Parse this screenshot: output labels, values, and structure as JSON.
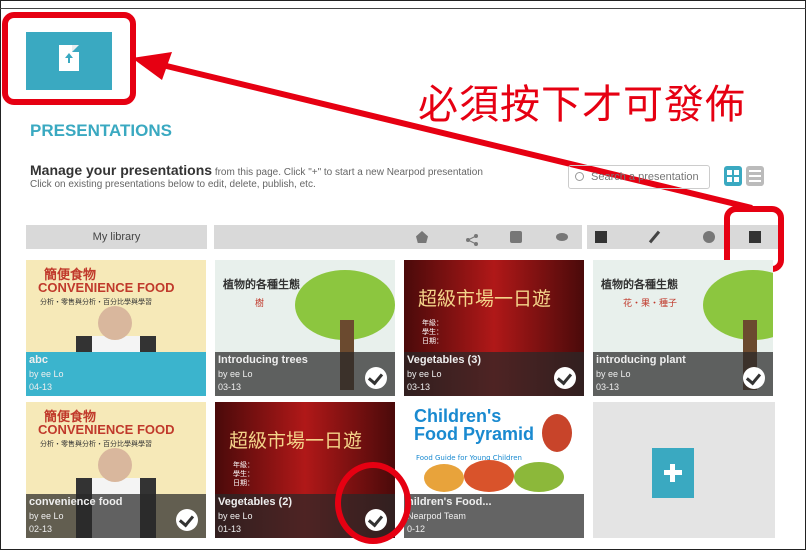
{
  "annotation": {
    "text": "必須按下才可發佈",
    "color": "#e60012"
  },
  "header": {
    "title": "PRESENTATIONS",
    "accent": "#3aa9c1"
  },
  "intro": {
    "bold": "Manage your presentations",
    "line1": " from this page. Click \"+\" to start a new Nearpod presentation",
    "line2": "Click on existing presentations below to edit, delete, publish, etc."
  },
  "search": {
    "placeholder": "Search a presentation"
  },
  "toolbar": {
    "library_label": "My library"
  },
  "cards": [
    {
      "title": "abc",
      "author": "by ee Lo",
      "date": "04-13",
      "selected": true,
      "thumb_text": [
        "簡便食物",
        "CONVENIENCE FOOD",
        "分析・零售與分析・百分比學與學習"
      ]
    },
    {
      "title": "Introducing trees",
      "author": "by ee Lo",
      "date": "03-13",
      "thumb_text": [
        "植物的各種生態",
        "樹"
      ]
    },
    {
      "title": "Vegetables (3)",
      "author": "by ee Lo",
      "date": "03-13",
      "thumb_text": [
        "超級市場一日遊",
        "年級：",
        "學生：",
        "日期："
      ]
    },
    {
      "title": "introducing plant",
      "author": "by ee Lo",
      "date": "03-13",
      "thumb_text": [
        "植物的各種生態",
        "花・果・種子"
      ]
    },
    {
      "title": "convenience food",
      "author": "by ee Lo",
      "date": "02-13",
      "thumb_text": [
        "簡便食物",
        "CONVENIENCE FOOD",
        "分析・零售與分析・百分比學與學習"
      ]
    },
    {
      "title": "Vegetables (2)",
      "author": "by ee Lo",
      "date": "01-13",
      "thumb_text": [
        "超級市場一日遊",
        "年級：",
        "學生：",
        "日期："
      ]
    },
    {
      "title": "hildren's Food...",
      "author": "Nearpod Team",
      "date": "0-12",
      "thumb_text": [
        "Children's",
        "Food Pyramid",
        "Food Guide for Young Children"
      ]
    }
  ]
}
